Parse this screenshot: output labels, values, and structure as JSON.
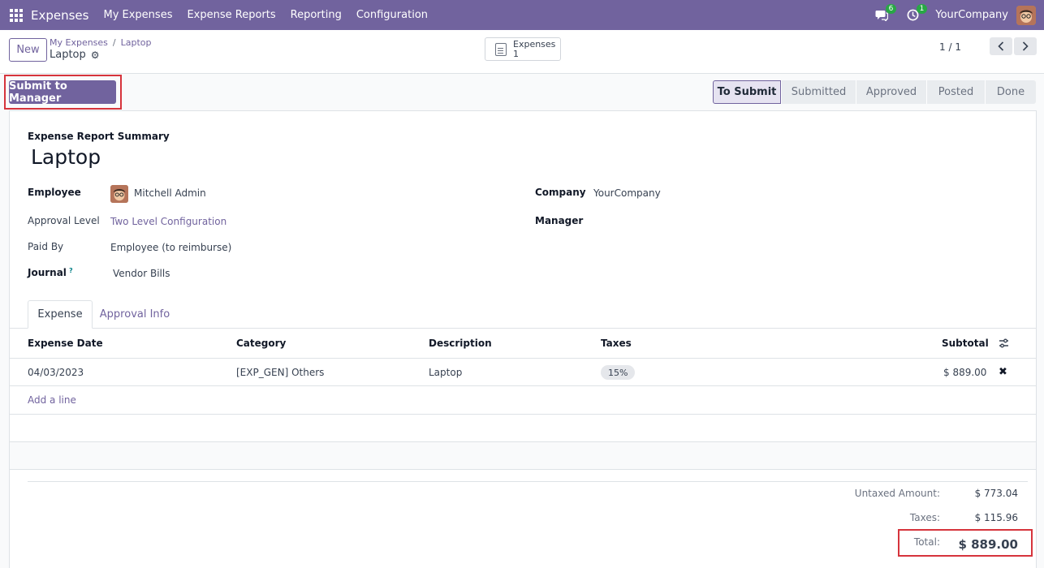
{
  "navbar": {
    "brand": "Expenses",
    "menu": [
      "My Expenses",
      "Expense Reports",
      "Reporting",
      "Configuration"
    ],
    "chat_badge": "6",
    "activity_badge": "1",
    "company": "YourCompany"
  },
  "control": {
    "new_label": "New",
    "breadcrumb_parent": "My Expenses",
    "breadcrumb_current": "Laptop",
    "record_title": "Laptop",
    "smart_button_label": "Expenses",
    "smart_button_count": "1",
    "pager": "1 / 1"
  },
  "statusbar": {
    "submit_label": "Submit to Manager",
    "stages": [
      "To Submit",
      "Submitted",
      "Approved",
      "Posted",
      "Done"
    ],
    "active_stage": "To Submit"
  },
  "form": {
    "summary_label": "Expense Report Summary",
    "name": "Laptop",
    "employee_label": "Employee",
    "employee_value": "Mitchell Admin",
    "approval_label": "Approval Level",
    "approval_value": "Two Level Configuration",
    "paid_by_label": "Paid By",
    "paid_by_value": "Employee (to reimburse)",
    "journal_label": "Journal",
    "journal_help": "?",
    "journal_value": "Vendor Bills",
    "company_label": "Company",
    "company_value": "YourCompany",
    "manager_label": "Manager"
  },
  "tabs": [
    "Expense",
    "Approval Info"
  ],
  "table": {
    "headers": [
      "Expense Date",
      "Category",
      "Description",
      "Taxes",
      "Subtotal"
    ],
    "rows": [
      {
        "date": "04/03/2023",
        "category": "[EXP_GEN] Others",
        "description": "Laptop",
        "tax": "15%",
        "subtotal": "$ 889.00"
      }
    ],
    "add_line": "Add a line"
  },
  "totals": {
    "untaxed_label": "Untaxed Amount:",
    "untaxed_value": "$ 773.04",
    "taxes_label": "Taxes:",
    "taxes_value": "$ 115.96",
    "total_label": "Total:",
    "total_value": "$ 889.00"
  },
  "colors": {
    "brand": "#71639e",
    "highlight": "#d6343c"
  }
}
